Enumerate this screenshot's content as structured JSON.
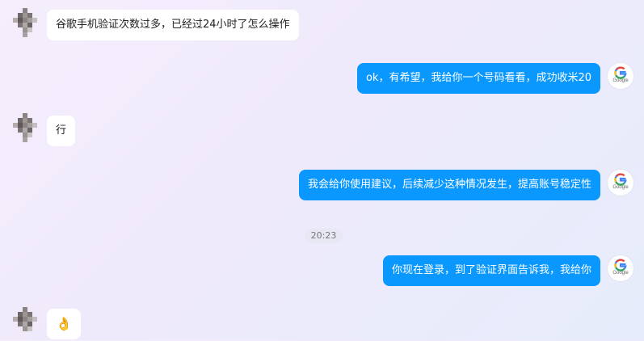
{
  "messages": [
    {
      "side": "in",
      "text": "谷歌手机验证次数过多，已经过24小时了怎么操作"
    },
    {
      "side": "out",
      "text": "ok，有希望，我给你一个号码看看，成功收米20"
    },
    {
      "side": "in",
      "text": "行"
    },
    {
      "side": "out",
      "text": "我会给你使用建议，后续减少这种情况发生，提高账号稳定性"
    },
    {
      "side": "out",
      "text": "你现在登录，到了验证界面告诉我，我给你"
    },
    {
      "side": "in",
      "text": "👌"
    }
  ],
  "time_label": "20:23",
  "agent_avatar": {
    "icon": "google-icon",
    "caption": "Google"
  },
  "colors": {
    "outgoing_bubble": "#0a98ff",
    "incoming_bubble": "#ffffff"
  }
}
